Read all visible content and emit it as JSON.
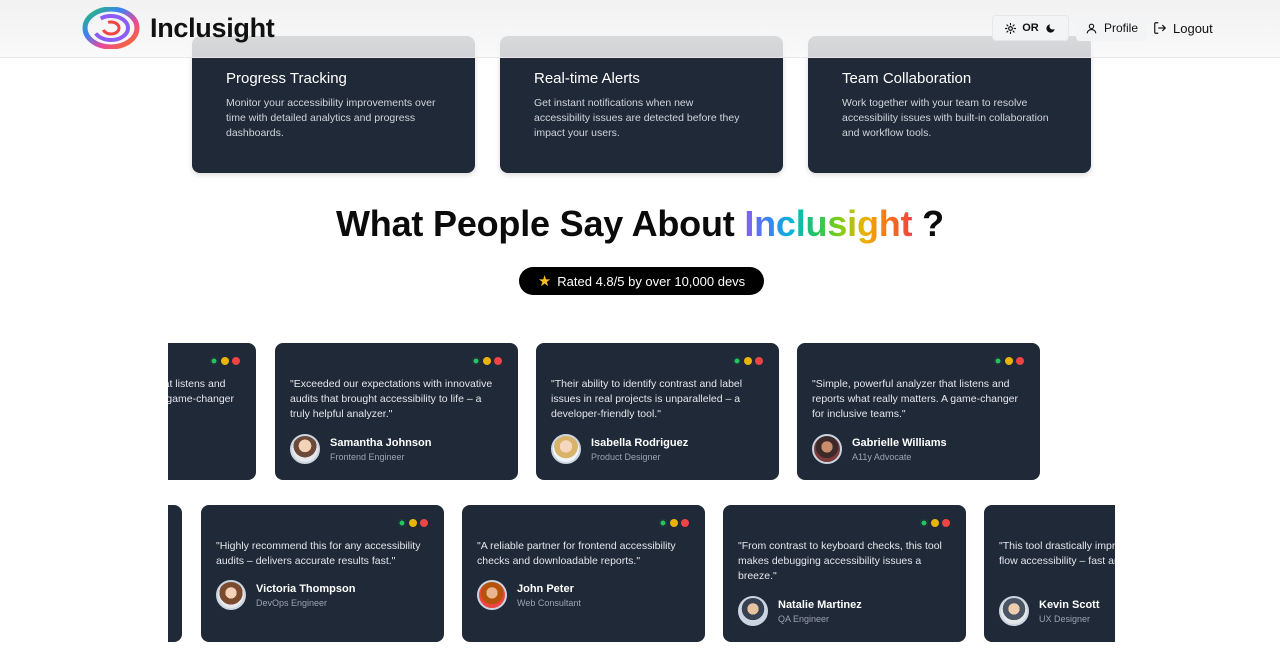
{
  "header": {
    "brand": "Inclusight",
    "theme_toggle": {
      "label": "OR",
      "icons": [
        "sun-icon",
        "moon-icon"
      ]
    },
    "profile_label": "Profile",
    "logout_label": "Logout"
  },
  "features": [
    {
      "title": "Progress Tracking",
      "desc": "Monitor your accessibility improvements over time with detailed analytics and progress dashboards."
    },
    {
      "title": "Real-time Alerts",
      "desc": "Get instant notifications when new accessibility issues are detected before they impact your users."
    },
    {
      "title": "Team Collaboration",
      "desc": "Work together with your team to resolve accessibility issues with built-in collaboration and workflow tools."
    }
  ],
  "testimonials_section": {
    "heading_prefix": "What People Say About",
    "heading_brand": "Inclusight",
    "heading_suffix": "?",
    "rating": "Rated 4.8/5 by over 10,000 devs"
  },
  "row1": [
    {
      "quote": "\"Simple, powerful analyzer that listens and reports what really matters. A game-changer for inclusive teams.\"",
      "name": "",
      "role": ""
    },
    {
      "quote": "\"Exceeded our expectations with innovative audits that brought accessibility to life – a truly helpful analyzer.\"",
      "name": "Samantha Johnson",
      "role": "Frontend Engineer"
    },
    {
      "quote": "\"Their ability to identify contrast and label issues in real projects is unparalleled – a developer-friendly tool.\"",
      "name": "Isabella Rodriguez",
      "role": "Product Designer"
    },
    {
      "quote": "\"Simple, powerful analyzer that listens and reports what really matters. A game-changer for inclusive teams.\"",
      "name": "Gabrielle Williams",
      "role": "A11y Advocate"
    }
  ],
  "row2": [
    {
      "quote": "\"Highly recommend this for any accessibility audits – delivers accurate results fast.\"",
      "name": "Victoria Thompson",
      "role": "DevOps Engineer"
    },
    {
      "quote": "\"A reliable partner for frontend accessibility checks and downloadable reports.\"",
      "name": "John Peter",
      "role": "Web Consultant"
    },
    {
      "quote": "\"From contrast to keyboard checks, this tool makes debugging accessibility issues a breeze.\"",
      "name": "Natalie Martinez",
      "role": "QA Engineer"
    },
    {
      "quote": "\"This tool drastically improved our onboarding flow accessibility – fast and reliable.\"",
      "name": "Kevin Scott",
      "role": "UX Designer"
    }
  ],
  "colors": {
    "card_bg": "#1f2937",
    "rating_pill_bg": "#000000",
    "dot_green": "#22c55e",
    "dot_yellow": "#eab308",
    "dot_red": "#ef4444"
  }
}
